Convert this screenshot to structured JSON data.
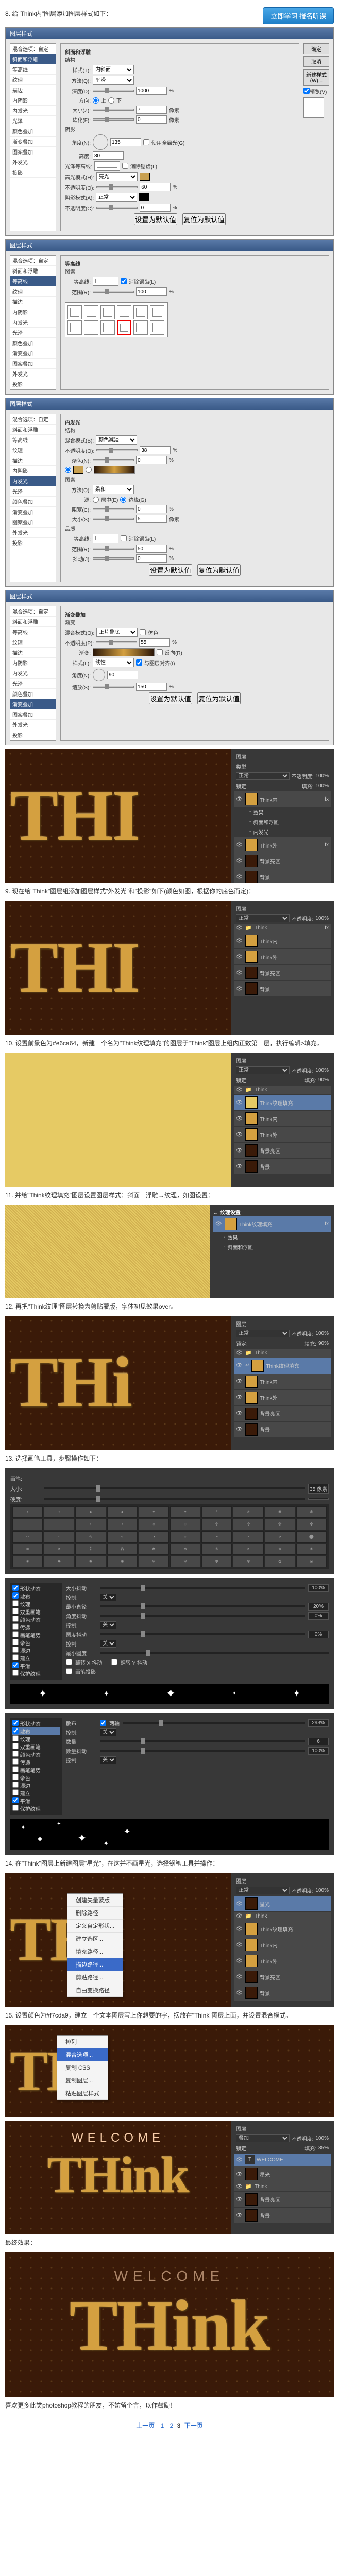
{
  "btn_learn": "立即学习\n报名听课",
  "step8": "8. 给\"Think内\"图层添加图层样式如下：",
  "layerStyle": {
    "title": "图层样式",
    "sideItems": [
      "混合选项：自定",
      "斜面和浮雕",
      "等高线",
      "纹理",
      "描边",
      "内阴影",
      "内发光",
      "光泽",
      "颜色叠加",
      "渐变叠加",
      "图案叠加",
      "外发光",
      "投影"
    ],
    "btns": [
      "确定",
      "取消",
      "新建样式(W)...",
      "预览(V)"
    ],
    "bevel": {
      "header": "斜面和浮雕",
      "struct": "结构",
      "style_l": "样式(T):",
      "style_v": "内斜面",
      "tech_l": "方法(Q):",
      "tech_v": "平滑",
      "depth_l": "深度(D):",
      "depth_v": "1000",
      "pct": "%",
      "dir_l": "方向:",
      "up": "上",
      "down": "下",
      "size_l": "大小(Z):",
      "size_v": "7",
      "px": "像素",
      "soft_l": "软化(F):",
      "soft_v": "0",
      "shade": "阴影",
      "angle_l": "角度(N):",
      "angle_v": "135",
      "global": "使用全局光(G)",
      "alt_l": "高度:",
      "alt_v": "30",
      "gloss_l": "光泽等高线:",
      "aa": "消除锯齿(L)",
      "hmode_l": "高光模式(H):",
      "hmode_v": "亮光",
      "hopac_l": "不透明度(O):",
      "hopac_v": "60",
      "smode_l": "阴影模式(A):",
      "smode_v": "正常",
      "sopac_l": "不透明度(C):",
      "sopac_v": "0",
      "reset": "设置为默认值",
      "reset2": "复位为默认值"
    },
    "contour": {
      "header": "等高线",
      "elem": "图素",
      "cont_l": "等高线:",
      "aa": "消除锯齿(L)",
      "range_l": "范围(R):",
      "range_v": "100"
    },
    "innerGlow": {
      "header": "内发光",
      "struct": "结构",
      "blend_l": "混合模式(B):",
      "blend_v": "颜色减淡",
      "opac_l": "不透明度(O):",
      "opac_v": "38",
      "noise_l": "杂色(N):",
      "noise_v": "0",
      "elem": "图素",
      "tech_l": "方法(Q):",
      "tech_v": "柔和",
      "src_l": "源:",
      "center": "居中(E)",
      "edge": "边缘(G)",
      "choke_l": "阻塞(C):",
      "choke_v": "0",
      "size_l": "大小(S):",
      "size_v": "5",
      "qual": "品质",
      "cont_l": "等高线:",
      "aa": "消除锯齿(L)",
      "range_l": "范围(R):",
      "range_v": "50",
      "jit_l": "抖动(J):",
      "jit_v": "0"
    },
    "gradOverlay": {
      "header": "渐变叠加",
      "grad": "渐变",
      "blend_l": "混合模式(O):",
      "blend_v": "正片叠底",
      "dither": "仿色",
      "opac_l": "不透明度(P):",
      "opac_v": "55",
      "grad_l": "渐变:",
      "rev": "反向(R)",
      "style_l": "样式(L):",
      "style_v": "线性",
      "align": "与图层对齐(I)",
      "angle_l": "角度(N):",
      "angle_v": "90",
      "scale_l": "缩放(S):",
      "scale_v": "150"
    }
  },
  "step9": "9. 现在给\"Think\"图层组添加图层样式\"外发光\"和\"投影\"如下(颜色如图，根据你的底色而定)：",
  "step10": "10. 设置前景色为#e6ca64，新建一个名为\"Think纹理填充\"的图层于\"Think\"图层上组内正数第一层，执行编辑>填充，",
  "step11": "11. 并给\"Think纹理填充\"图层设置图层样式：斜面一浮雕→纹理，如图设置：",
  "step12": "12. 再把\"Think纹理\"图层转换为剪贴蒙版，字体初见效果over。",
  "step13": "13. 选择画笔工具，步骤操作如下：",
  "brush": {
    "brush_l": "画笔:",
    "size_l": "大小:",
    "size_v": "35 像素",
    "hard_l": "硬度:",
    "hard_v": "",
    "spacing": "间距",
    "shape": "形状动态",
    "scatter": "散布",
    "texture": "纹理",
    "dual": "双重画笔",
    "color": "颜色动态",
    "transfer": "传递",
    "pose": "画笔笔势",
    "noise": "杂色",
    "wet": "湿边",
    "build": "建立",
    "smooth": "平滑",
    "protect": "保护纹理",
    "sizeJit_l": "大小抖动",
    "sizeJit_v": "100%",
    "ctrl_l": "控制:",
    "ctrl_v": "关",
    "minDia_l": "最小直径",
    "minDia_v": "20%",
    "angJit_l": "角度抖动",
    "angJit_v": "0%",
    "rndJit_l": "圆度抖动",
    "rndJit_v": "0%",
    "minRnd_l": "最小圆度",
    "flipX": "翻转 X 抖动",
    "flipY": "翻转 Y 抖动",
    "proj": "画笔投影",
    "scat_l": "散布",
    "both": "两轴",
    "scat_v": "293%",
    "count_l": "数量",
    "count_v": "6",
    "cntJit_l": "数量抖动",
    "cntJit_v": "100%"
  },
  "step14": "14. 在\"Think\"图层上新建图层\"星光\"，在这并不画星光，选择钢笔工具并操作：",
  "ctx": {
    "items": [
      "创建矢量蒙版",
      "删除路径",
      "定义自定形状...",
      "建立选区...",
      "填充路径...",
      "描边路径...",
      "剪贴路径...",
      "自由变换路径",
      "排列",
      "混合选项...",
      "复制 CSS",
      "复制图层...",
      "粘贴图层样式"
    ],
    "hl": "描边路径..."
  },
  "step15": "15. 设置颜色为#f7cda9，建立一个文本图层写上你想要的字，摆放在\"Think\"图层上面，并设置混合模式。",
  "layers": {
    "panel": "图层",
    "kind": "类型",
    "normal": "正常",
    "overlay": "叠加",
    "opac": "不透明度:",
    "opac_v": "100%",
    "lock": "锁定:",
    "fill": "填充:",
    "fill_v": "100%",
    "fill_v2": "90%",
    "fill_v3": "35%",
    "names": [
      "Think纹理填充",
      "Think内",
      "Think外",
      "背景亮区",
      "背景",
      "WELCOME",
      "星光",
      "Think"
    ],
    "fx": "fx",
    "effects": "效果",
    "ig": "内发光",
    "ptn": "图案叠加",
    "bev": "斜面和浮雕"
  },
  "final_text": "WELCOME",
  "final_think": "THink",
  "end": "最终效果：",
  "footer": "喜欢更多此类photoshop教程的朋友，不妨留个言，以作鼓励！",
  "pager": {
    "prev": "上一页",
    "p1": "1",
    "p2": "2",
    "p3": "3",
    "next": "下一页"
  }
}
